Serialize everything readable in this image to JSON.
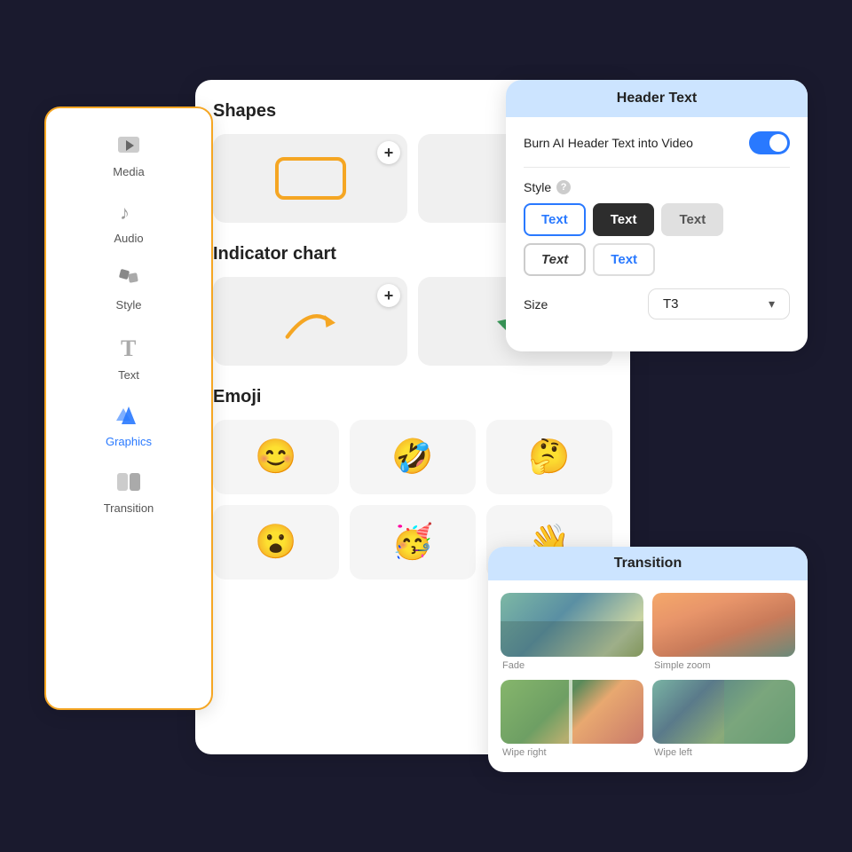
{
  "sidebar": {
    "items": [
      {
        "id": "media",
        "label": "Media",
        "icon": "▶",
        "active": false
      },
      {
        "id": "audio",
        "label": "Audio",
        "icon": "♪",
        "active": false
      },
      {
        "id": "style",
        "label": "Style",
        "icon": "🎨",
        "active": false
      },
      {
        "id": "text",
        "label": "Text",
        "icon": "T",
        "active": false
      },
      {
        "id": "graphics",
        "label": "Graphics",
        "icon": "✦",
        "active": true
      },
      {
        "id": "transition",
        "label": "Transition",
        "icon": "⊞",
        "active": false
      }
    ]
  },
  "main_panel": {
    "shapes_title": "Shapes",
    "indicator_title": "Indicator chart",
    "emoji_title": "Emoji",
    "emoji_items": [
      "😊",
      "🤣",
      "🤔",
      "😮",
      "🥳",
      "👋"
    ]
  },
  "header_text_popup": {
    "title": "Header Text",
    "burn_label": "Burn AI Header Text into Video",
    "toggle_on": true,
    "style_label": "Style",
    "style_options": [
      {
        "id": "plain",
        "label": "Text",
        "variant": "selected"
      },
      {
        "id": "dark",
        "label": "Text",
        "variant": "dark"
      },
      {
        "id": "gray",
        "label": "Text",
        "variant": "gray"
      },
      {
        "id": "outline",
        "label": "Text",
        "variant": "outline"
      },
      {
        "id": "blue",
        "label": "Text",
        "variant": "blue-text"
      }
    ],
    "size_label": "Size",
    "size_value": "T3"
  },
  "transition_popup": {
    "title": "Transition",
    "items": [
      {
        "id": "fade",
        "label": "Fade",
        "thumb": "fade"
      },
      {
        "id": "simple-zoom",
        "label": "Simple zoom",
        "thumb": "zoom"
      },
      {
        "id": "wipe-right",
        "label": "Wipe right",
        "thumb": "wipe-right"
      },
      {
        "id": "wipe-left",
        "label": "Wipe left",
        "thumb": "wipe-left"
      }
    ]
  }
}
